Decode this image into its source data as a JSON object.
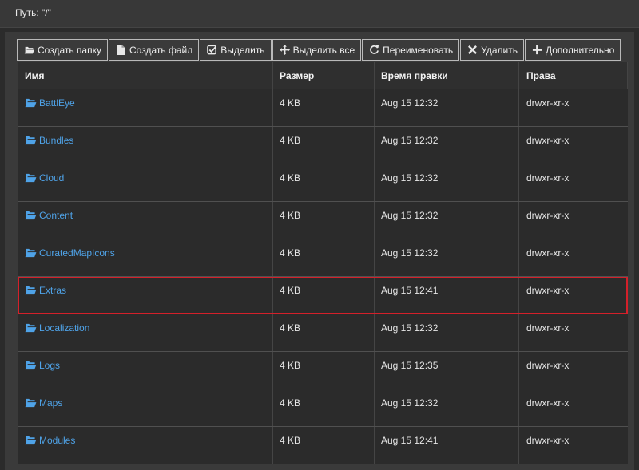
{
  "path": {
    "label": "Путь: \"/\""
  },
  "toolbar": {
    "buttons": [
      {
        "label": "Создать папку",
        "icon": "folder-open-icon"
      },
      {
        "label": "Создать файл",
        "icon": "file-icon"
      },
      {
        "label": "Выделить",
        "icon": "check-square-icon"
      },
      {
        "label": "Выделить все",
        "icon": "move-arrows-icon"
      },
      {
        "label": "Переименовать",
        "icon": "refresh-icon"
      },
      {
        "label": "Удалить",
        "icon": "close-icon"
      },
      {
        "label": "Дополнительно",
        "icon": "plus-icon"
      }
    ]
  },
  "table": {
    "headers": {
      "name": "Имя",
      "size": "Размер",
      "modified": "Время правки",
      "perms": "Права"
    },
    "rows": [
      {
        "name": "BattlEye",
        "size": "4 KB",
        "modified": "Aug 15 12:32",
        "perms": "drwxr-xr-x"
      },
      {
        "name": "Bundles",
        "size": "4 KB",
        "modified": "Aug 15 12:32",
        "perms": "drwxr-xr-x"
      },
      {
        "name": "Cloud",
        "size": "4 KB",
        "modified": "Aug 15 12:32",
        "perms": "drwxr-xr-x"
      },
      {
        "name": "Content",
        "size": "4 KB",
        "modified": "Aug 15 12:32",
        "perms": "drwxr-xr-x"
      },
      {
        "name": "CuratedMapIcons",
        "size": "4 KB",
        "modified": "Aug 15 12:32",
        "perms": "drwxr-xr-x"
      },
      {
        "name": "Extras",
        "size": "4 KB",
        "modified": "Aug 15 12:41",
        "perms": "drwxr-xr-x"
      },
      {
        "name": "Localization",
        "size": "4 KB",
        "modified": "Aug 15 12:32",
        "perms": "drwxr-xr-x"
      },
      {
        "name": "Logs",
        "size": "4 KB",
        "modified": "Aug 15 12:35",
        "perms": "drwxr-xr-x"
      },
      {
        "name": "Maps",
        "size": "4 KB",
        "modified": "Aug 15 12:32",
        "perms": "drwxr-xr-x"
      },
      {
        "name": "Modules",
        "size": "4 KB",
        "modified": "Aug 15 12:41",
        "perms": "drwxr-xr-x"
      }
    ]
  },
  "colors": {
    "link": "#4fa3e8",
    "highlight": "#d4202a",
    "background": "#2b2b2b"
  }
}
